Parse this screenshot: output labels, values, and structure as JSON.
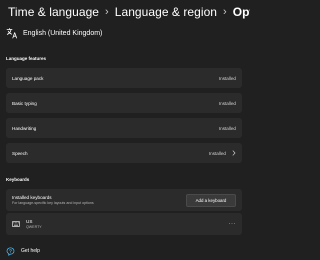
{
  "breadcrumb": {
    "items": [
      "Time & language",
      "Language & region"
    ],
    "current": "Options",
    "separator": "›"
  },
  "language": {
    "name": "English (United Kingdom)",
    "icon": "language-icon"
  },
  "language_features": {
    "title": "Language features",
    "items": [
      {
        "label": "Language pack",
        "status": "Installed"
      },
      {
        "label": "Basic typing",
        "status": "Installed"
      },
      {
        "label": "Handwriting",
        "status": "Installed"
      },
      {
        "label": "Speech",
        "status": "Installed",
        "icon": "chevron-right-icon"
      }
    ]
  },
  "keyboards": {
    "title": "Keyboards",
    "installed_title": "Installed keyboards",
    "installed_subtitle": "For language-specific key layouts and input options",
    "add_button": "Add a keyboard",
    "list": [
      {
        "name": "US",
        "layout": "QWERTY",
        "icon": "keyboard-icon",
        "more_icon": "more-options-icon"
      }
    ]
  },
  "footer": {
    "help_label": "Get help",
    "help_icon": "help-icon"
  },
  "colors": {
    "background": "#202020",
    "card": "#2b2b2b",
    "button": "#3a3a3a",
    "text": "#ffffff",
    "secondary_text": "#cfcfcf"
  }
}
